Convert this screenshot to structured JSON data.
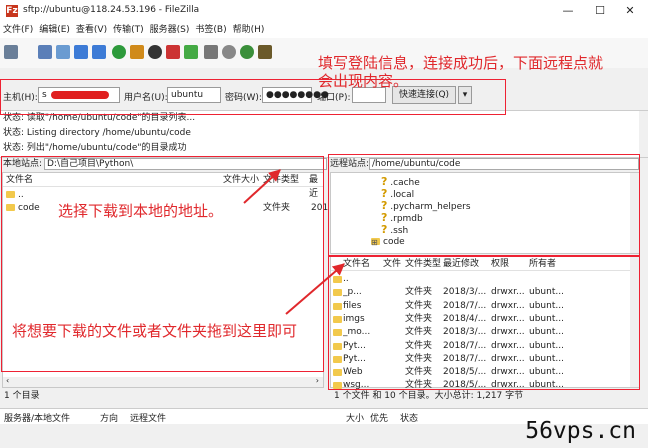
{
  "titlebar": {
    "title": "sftp://ubuntu@118.24.53.196 - FileZilla",
    "app_icon": "Fz",
    "minimize": "—",
    "maximize": "☐",
    "close": "✕"
  },
  "menu": [
    "文件(F)",
    "编辑(E)",
    "查看(V)",
    "传输(T)",
    "服务器(S)",
    "书签(B)",
    "帮助(H)"
  ],
  "quickconnect": {
    "host_label": "主机(H):",
    "host_value": "s",
    "user_label": "用户名(U):",
    "user_value": "ubuntu",
    "pass_label": "密码(W):",
    "pass_value": "●●●●●●●●",
    "port_label": "端口(P):",
    "port_value": "",
    "connect_label": "快速连接(Q)",
    "dropdown": "▾"
  },
  "log": [
    "状态:  读取\"/home/ubuntu/code\"的目录列表...",
    "状态:  Listing directory /home/ubuntu/code",
    "状态:  列出\"/home/ubuntu/code\"的目录成功"
  ],
  "local": {
    "site_label": "本地站点:",
    "site_path": "D:\\自己项目\\Python\\",
    "headers": {
      "name": "文件名",
      "size": "文件大小",
      "type": "文件类型",
      "modified": "最近"
    },
    "rows": [
      {
        "name": "..",
        "size": "",
        "type": "",
        "modified": ""
      },
      {
        "name": "code",
        "size": "",
        "type": "文件夹",
        "modified": "201"
      }
    ],
    "status": "1 个目录"
  },
  "remote": {
    "site_label": "远程站点:",
    "site_path": "/home/ubuntu/code",
    "tree": [
      ".cache",
      ".local",
      ".pycharm_helpers",
      ".rpmdb",
      ".ssh",
      "code"
    ],
    "headers": {
      "name": "文件名",
      "size": "文件",
      "type": "文件类型",
      "modified": "最近修改",
      "perm": "权限",
      "owner": "所有者"
    },
    "rows": [
      {
        "name": "..",
        "type": "",
        "modified": "",
        "perm": "",
        "owner": ""
      },
      {
        "name": "_p...",
        "type": "文件夹",
        "modified": "2018/3/...",
        "perm": "drwxr...",
        "owner": "ubunt..."
      },
      {
        "name": "files",
        "type": "文件夹",
        "modified": "2018/7/...",
        "perm": "drwxr...",
        "owner": "ubunt..."
      },
      {
        "name": "imgs",
        "type": "文件夹",
        "modified": "2018/4/...",
        "perm": "drwxr...",
        "owner": "ubunt..."
      },
      {
        "name": "_mo...",
        "type": "文件夹",
        "modified": "2018/3/...",
        "perm": "drwxr...",
        "owner": "ubunt..."
      },
      {
        "name": "Pyt...",
        "type": "文件夹",
        "modified": "2018/7/...",
        "perm": "drwxr...",
        "owner": "ubunt..."
      },
      {
        "name": "Pyt...",
        "type": "文件夹",
        "modified": "2018/7/...",
        "perm": "drwxr...",
        "owner": "ubunt..."
      },
      {
        "name": "Web",
        "type": "文件夹",
        "modified": "2018/5/...",
        "perm": "drwxr...",
        "owner": "ubunt..."
      },
      {
        "name": "wsg...",
        "type": "文件夹",
        "modified": "2018/5/...",
        "perm": "drwxr...",
        "owner": "ubunt..."
      }
    ],
    "status": "1 个文件 和 10 个目录。大小总计: 1,217 字节"
  },
  "queue": {
    "server_file": "服务器/本地文件",
    "direction": "方向",
    "remote_file": "远程文件",
    "size": "大小",
    "priority": "优先",
    "state": "状态"
  },
  "annotations": {
    "login": "填写登陆信息，连接成功后，下面远程点就",
    "login2": "会出现内容。",
    "local": "选择下载到本地的地址。",
    "drag": "将想要下载的文件或者文件夹拖到这里即可"
  },
  "watermark": "56vps.cn",
  "colors": {
    "annotation": "#e0282c",
    "folder": "#f2c94c"
  }
}
